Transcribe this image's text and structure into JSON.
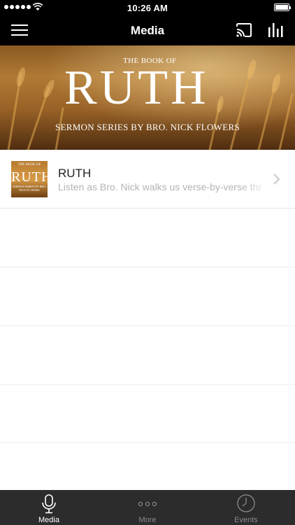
{
  "status_bar": {
    "time": "10:26 AM"
  },
  "nav": {
    "title": "Media",
    "menu_icon": "hamburger-menu-icon",
    "cast_icon": "cast-icon",
    "bars_icon": "bar-chart-icon"
  },
  "hero": {
    "kicker": "THE BOOK OF",
    "title": "RUTH",
    "subtitle": "SERMON SERIES BY BRO. NICK FLOWERS"
  },
  "media_list": [
    {
      "title": "RUTH",
      "description": "Listen as Bro. Nick walks us verse-by-verse thr",
      "thumb": {
        "kicker": "THE BOOK OF",
        "title": "RUTH",
        "subtitle": "SERMON SERIES BY BRO. NICK FLOWERS"
      }
    }
  ],
  "tabs": [
    {
      "label": "Media",
      "icon": "microphone-icon",
      "active": true
    },
    {
      "label": "More",
      "icon": "more-dots-icon",
      "active": false
    },
    {
      "label": "Events",
      "icon": "clock-icon",
      "active": false
    }
  ],
  "colors": {
    "bar_background": "#000000",
    "tab_background": "#2c2c2c",
    "tab_active": "#ffffff",
    "tab_inactive": "#8a8a8a",
    "description_text": "#b3b3b3"
  }
}
